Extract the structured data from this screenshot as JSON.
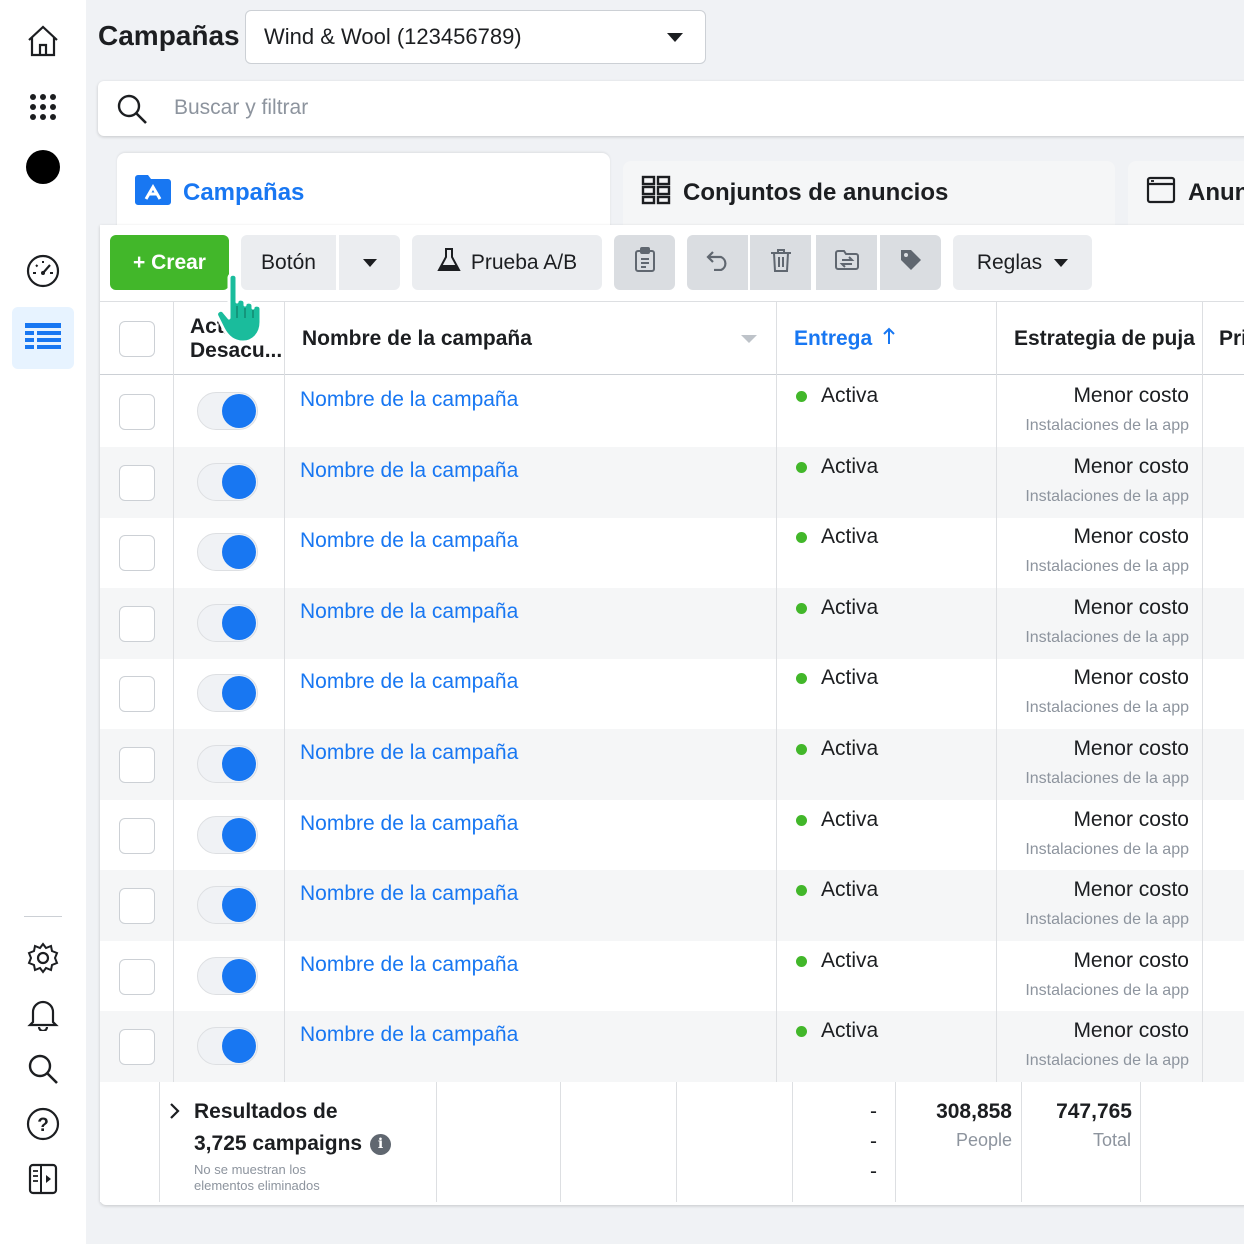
{
  "nav": {
    "items": [
      "home",
      "apps",
      "account",
      "dashboard",
      "ads-manager",
      "settings",
      "notifications",
      "search",
      "help",
      "sidebar"
    ]
  },
  "header": {
    "title": "Campañas",
    "account_selector": "Wind & Wool (123456789)"
  },
  "search": {
    "placeholder": "Buscar y filtrar"
  },
  "tabs": [
    {
      "label": "Campañas"
    },
    {
      "label": "Conjuntos de anuncios"
    },
    {
      "label": "Anun"
    }
  ],
  "toolbar": {
    "create_label": "+ Crear",
    "button_label": "Botón",
    "ab_test_label": "Prueba A/B",
    "rules_label": "Reglas"
  },
  "table": {
    "columns": {
      "active": "Act/ Desacu...",
      "name": "Nombre de la campaña",
      "delivery": "Entrega",
      "bid_strategy": "Estrategia de puja",
      "next": "Pri"
    },
    "rows": [
      {
        "name": "Nombre de la campaña",
        "delivery": "Activa",
        "bid": "Menor costo",
        "bid_sub": "Instalaciones de la app"
      },
      {
        "name": "Nombre de la campaña",
        "delivery": "Activa",
        "bid": "Menor costo",
        "bid_sub": "Instalaciones de la app"
      },
      {
        "name": "Nombre de la campaña",
        "delivery": "Activa",
        "bid": "Menor costo",
        "bid_sub": "Instalaciones de la app"
      },
      {
        "name": "Nombre de la campaña",
        "delivery": "Activa",
        "bid": "Menor costo",
        "bid_sub": "Instalaciones de la app"
      },
      {
        "name": "Nombre de la campaña",
        "delivery": "Activa",
        "bid": "Menor costo",
        "bid_sub": "Instalaciones de la app"
      },
      {
        "name": "Nombre de la campaña",
        "delivery": "Activa",
        "bid": "Menor costo",
        "bid_sub": "Instalaciones de la app"
      },
      {
        "name": "Nombre de la campaña",
        "delivery": "Activa",
        "bid": "Menor costo",
        "bid_sub": "Instalaciones de la app"
      },
      {
        "name": "Nombre de la campaña",
        "delivery": "Activa",
        "bid": "Menor costo",
        "bid_sub": "Instalaciones de la app"
      },
      {
        "name": "Nombre de la campaña",
        "delivery": "Activa",
        "bid": "Menor costo",
        "bid_sub": "Instalaciones de la app"
      },
      {
        "name": "Nombre de la campaña",
        "delivery": "Activa",
        "bid": "Menor costo",
        "bid_sub": "Instalaciones de la app"
      }
    ]
  },
  "footer": {
    "results_line1": "Resultados de",
    "results_line2": "3,725 campaigns",
    "note_line1": "No se muestran los",
    "note_line2": "elementos eliminados",
    "dash": "-",
    "people_value": "308,858",
    "people_label": "People",
    "total_value": "747,765",
    "total_label": "Total"
  },
  "colors": {
    "accent": "#1877f2",
    "create": "#42b72a",
    "status_active": "#42b72a",
    "cursor": "#1abc9c"
  }
}
